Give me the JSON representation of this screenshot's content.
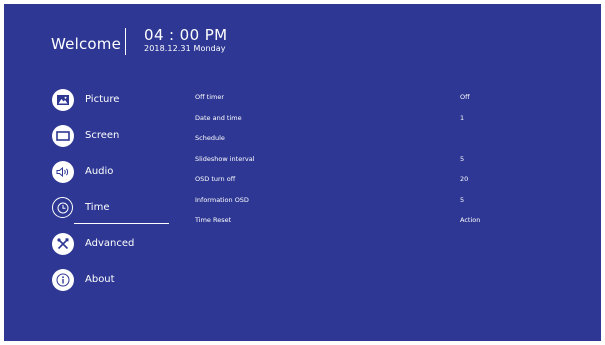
{
  "header": {
    "welcome": "Welcome",
    "time": "04 : 00 PM",
    "date": "2018.12.31 Monday"
  },
  "sidebar": {
    "items": [
      {
        "label": "Picture",
        "icon": "picture-icon",
        "active": false
      },
      {
        "label": "Screen",
        "icon": "screen-icon",
        "active": false
      },
      {
        "label": "Audio",
        "icon": "speaker-icon",
        "active": false
      },
      {
        "label": "Time",
        "icon": "clock-icon",
        "active": true
      },
      {
        "label": "Advanced",
        "icon": "tools-icon",
        "active": false
      },
      {
        "label": "About",
        "icon": "info-icon",
        "active": false
      }
    ]
  },
  "settings": {
    "rows": [
      {
        "label": "Off timer",
        "value": "Off"
      },
      {
        "label": "Date and time",
        "value": "1"
      },
      {
        "label": "Schedule",
        "value": ""
      },
      {
        "label": "Slideshow interval",
        "value": "5"
      },
      {
        "label": "OSD turn off",
        "value": "20"
      },
      {
        "label": "Information OSD",
        "value": "5"
      },
      {
        "label": "Time Reset",
        "value": "Action"
      }
    ]
  },
  "colors": {
    "background": "#2e3894",
    "text": "#ffffff"
  }
}
